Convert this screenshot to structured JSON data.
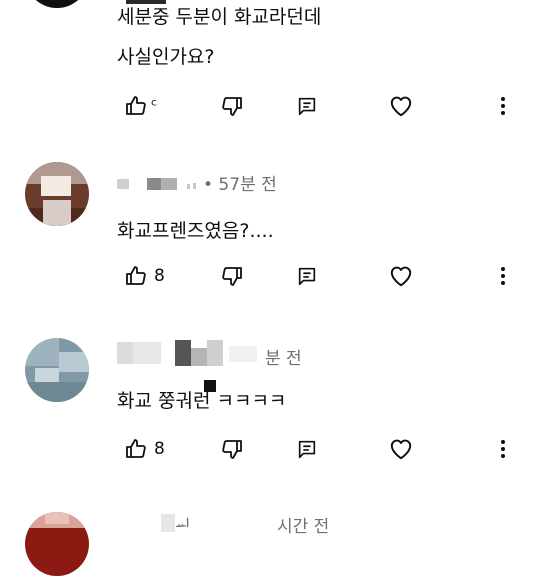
{
  "comments": [
    {
      "lines": [
        "세분중 두분이 화교라던데",
        "사실인가요?"
      ],
      "time": "",
      "like_count": "",
      "author": ""
    },
    {
      "lines": [
        "화교프렌즈였음?...."
      ],
      "time": "• 57분 전",
      "like_count": "8",
      "author": ""
    },
    {
      "lines": [
        "화교 쭝궈런 ㅋㅋㅋㅋ"
      ],
      "time": "분 전",
      "like_count": "8",
      "author": ""
    },
    {
      "lines": [],
      "time": "시간 전",
      "like_count": "",
      "author": ""
    }
  ],
  "icons": {
    "like": "thumb-up-icon",
    "dislike": "thumb-down-icon",
    "reply": "reply-icon",
    "heart": "heart-icon",
    "more": "more-vert-icon"
  },
  "colors": {
    "text": "#0f0f0f",
    "secondary": "#707070",
    "background": "#ffffff"
  }
}
